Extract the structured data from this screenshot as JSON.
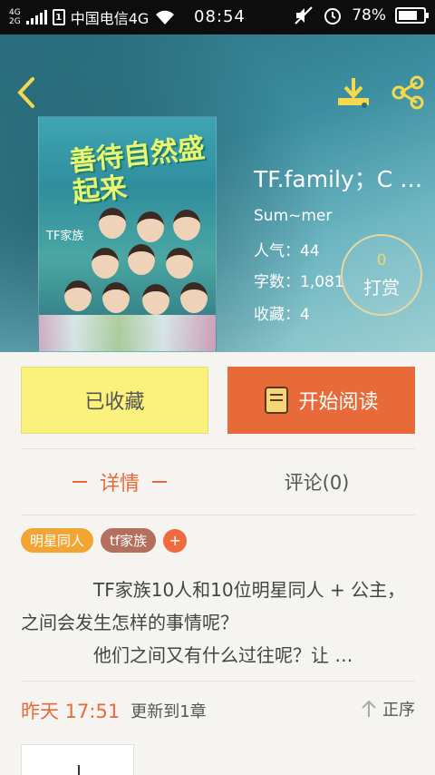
{
  "status_bar": {
    "network_top": "4G",
    "network_bottom": "2G",
    "sim_label": "1",
    "carrier": "中国电信4G",
    "time": "08:54",
    "battery": "78%",
    "battery_level": 0.78
  },
  "book": {
    "title": "TF.family；C …",
    "author": "Sum~mer",
    "popularity": "人气：44",
    "word_count": "字数：1,081",
    "favorites": "收藏：4",
    "cover_title": "善待自然盛起来",
    "cover_brand": "TF家族"
  },
  "tip": {
    "count": "0",
    "label": "打赏"
  },
  "actions": {
    "collected_label": "已收藏",
    "read_label": "开始阅读"
  },
  "tabs": {
    "detail": "详情",
    "comments": "评论(0)"
  },
  "tags": [
    "明星同人",
    "tf家族"
  ],
  "tag_add": "+",
  "description": {
    "line1": "TF家族10人和10位明星同人 + 公主，之间会发生怎样的事情呢？",
    "line2": "他们之间又有什么过往呢？让 …"
  },
  "update": {
    "time": "昨天 17:51",
    "info": "更新到1章",
    "sort_label": "正序"
  },
  "colors": {
    "accent": "#e86a39",
    "collected_bg": "#fbf17d",
    "tag_1": "#f3a533",
    "tag_2": "#b46f5e"
  }
}
